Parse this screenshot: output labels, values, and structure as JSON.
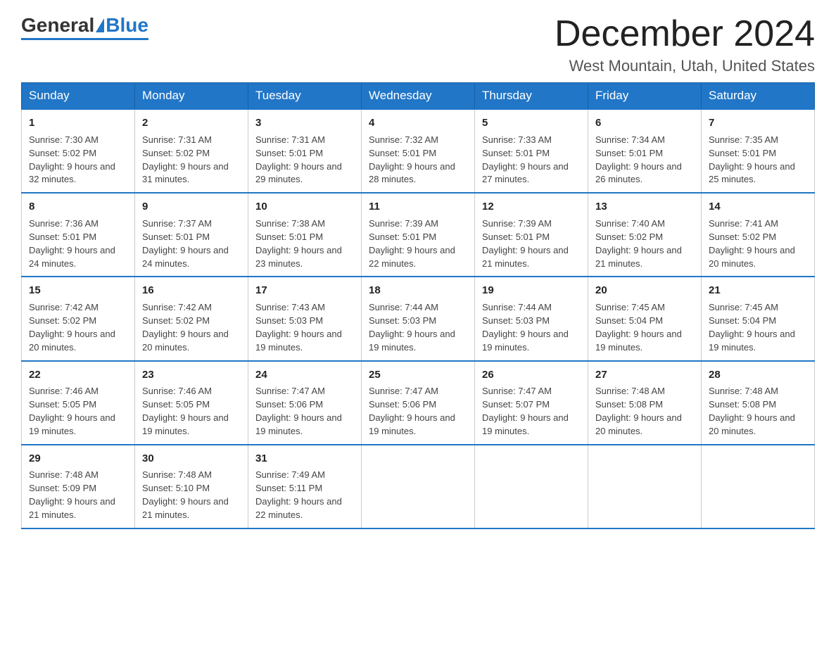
{
  "header": {
    "logo": {
      "general": "General",
      "blue": "Blue"
    },
    "title": "December 2024",
    "location": "West Mountain, Utah, United States"
  },
  "days_of_week": [
    "Sunday",
    "Monday",
    "Tuesday",
    "Wednesday",
    "Thursday",
    "Friday",
    "Saturday"
  ],
  "weeks": [
    [
      {
        "day": "1",
        "sunrise": "7:30 AM",
        "sunset": "5:02 PM",
        "daylight": "9 hours and 32 minutes."
      },
      {
        "day": "2",
        "sunrise": "7:31 AM",
        "sunset": "5:02 PM",
        "daylight": "9 hours and 31 minutes."
      },
      {
        "day": "3",
        "sunrise": "7:31 AM",
        "sunset": "5:01 PM",
        "daylight": "9 hours and 29 minutes."
      },
      {
        "day": "4",
        "sunrise": "7:32 AM",
        "sunset": "5:01 PM",
        "daylight": "9 hours and 28 minutes."
      },
      {
        "day": "5",
        "sunrise": "7:33 AM",
        "sunset": "5:01 PM",
        "daylight": "9 hours and 27 minutes."
      },
      {
        "day": "6",
        "sunrise": "7:34 AM",
        "sunset": "5:01 PM",
        "daylight": "9 hours and 26 minutes."
      },
      {
        "day": "7",
        "sunrise": "7:35 AM",
        "sunset": "5:01 PM",
        "daylight": "9 hours and 25 minutes."
      }
    ],
    [
      {
        "day": "8",
        "sunrise": "7:36 AM",
        "sunset": "5:01 PM",
        "daylight": "9 hours and 24 minutes."
      },
      {
        "day": "9",
        "sunrise": "7:37 AM",
        "sunset": "5:01 PM",
        "daylight": "9 hours and 24 minutes."
      },
      {
        "day": "10",
        "sunrise": "7:38 AM",
        "sunset": "5:01 PM",
        "daylight": "9 hours and 23 minutes."
      },
      {
        "day": "11",
        "sunrise": "7:39 AM",
        "sunset": "5:01 PM",
        "daylight": "9 hours and 22 minutes."
      },
      {
        "day": "12",
        "sunrise": "7:39 AM",
        "sunset": "5:01 PM",
        "daylight": "9 hours and 21 minutes."
      },
      {
        "day": "13",
        "sunrise": "7:40 AM",
        "sunset": "5:02 PM",
        "daylight": "9 hours and 21 minutes."
      },
      {
        "day": "14",
        "sunrise": "7:41 AM",
        "sunset": "5:02 PM",
        "daylight": "9 hours and 20 minutes."
      }
    ],
    [
      {
        "day": "15",
        "sunrise": "7:42 AM",
        "sunset": "5:02 PM",
        "daylight": "9 hours and 20 minutes."
      },
      {
        "day": "16",
        "sunrise": "7:42 AM",
        "sunset": "5:02 PM",
        "daylight": "9 hours and 20 minutes."
      },
      {
        "day": "17",
        "sunrise": "7:43 AM",
        "sunset": "5:03 PM",
        "daylight": "9 hours and 19 minutes."
      },
      {
        "day": "18",
        "sunrise": "7:44 AM",
        "sunset": "5:03 PM",
        "daylight": "9 hours and 19 minutes."
      },
      {
        "day": "19",
        "sunrise": "7:44 AM",
        "sunset": "5:03 PM",
        "daylight": "9 hours and 19 minutes."
      },
      {
        "day": "20",
        "sunrise": "7:45 AM",
        "sunset": "5:04 PM",
        "daylight": "9 hours and 19 minutes."
      },
      {
        "day": "21",
        "sunrise": "7:45 AM",
        "sunset": "5:04 PM",
        "daylight": "9 hours and 19 minutes."
      }
    ],
    [
      {
        "day": "22",
        "sunrise": "7:46 AM",
        "sunset": "5:05 PM",
        "daylight": "9 hours and 19 minutes."
      },
      {
        "day": "23",
        "sunrise": "7:46 AM",
        "sunset": "5:05 PM",
        "daylight": "9 hours and 19 minutes."
      },
      {
        "day": "24",
        "sunrise": "7:47 AM",
        "sunset": "5:06 PM",
        "daylight": "9 hours and 19 minutes."
      },
      {
        "day": "25",
        "sunrise": "7:47 AM",
        "sunset": "5:06 PM",
        "daylight": "9 hours and 19 minutes."
      },
      {
        "day": "26",
        "sunrise": "7:47 AM",
        "sunset": "5:07 PM",
        "daylight": "9 hours and 19 minutes."
      },
      {
        "day": "27",
        "sunrise": "7:48 AM",
        "sunset": "5:08 PM",
        "daylight": "9 hours and 20 minutes."
      },
      {
        "day": "28",
        "sunrise": "7:48 AM",
        "sunset": "5:08 PM",
        "daylight": "9 hours and 20 minutes."
      }
    ],
    [
      {
        "day": "29",
        "sunrise": "7:48 AM",
        "sunset": "5:09 PM",
        "daylight": "9 hours and 21 minutes."
      },
      {
        "day": "30",
        "sunrise": "7:48 AM",
        "sunset": "5:10 PM",
        "daylight": "9 hours and 21 minutes."
      },
      {
        "day": "31",
        "sunrise": "7:49 AM",
        "sunset": "5:11 PM",
        "daylight": "9 hours and 22 minutes."
      },
      null,
      null,
      null,
      null
    ]
  ],
  "labels": {
    "sunrise": "Sunrise:",
    "sunset": "Sunset:",
    "daylight": "Daylight:"
  }
}
